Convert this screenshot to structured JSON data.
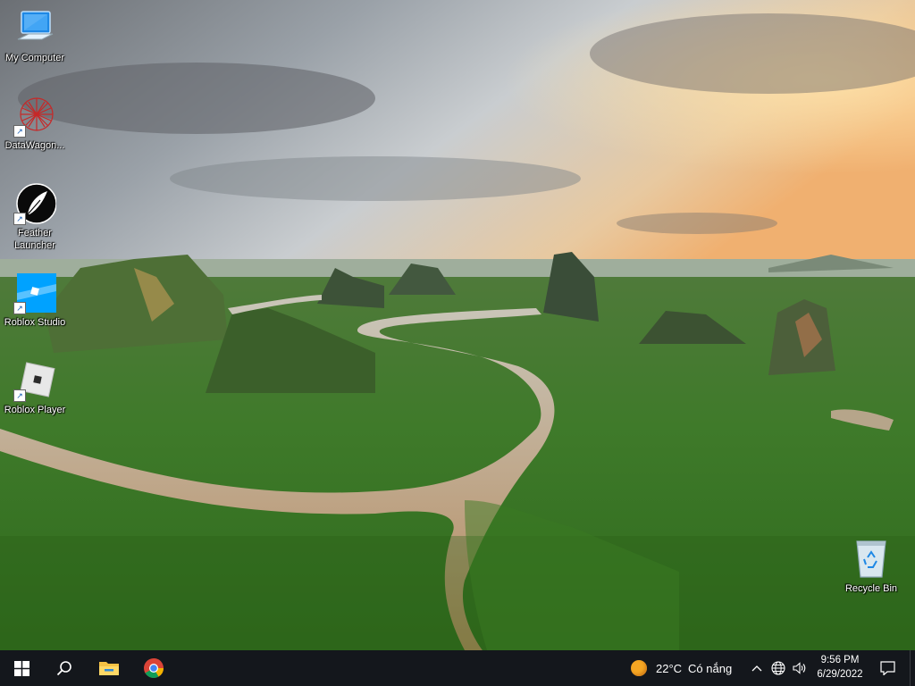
{
  "desktop": {
    "icons": [
      {
        "label": "My Computer",
        "icon": "computer-icon"
      },
      {
        "label": "DataWagon...",
        "icon": "datawagon-icon"
      },
      {
        "label": "Feather Launcher",
        "icon": "feather-launcher-icon"
      },
      {
        "label": "Roblox Studio",
        "icon": "roblox-studio-icon"
      },
      {
        "label": "Roblox Player",
        "icon": "roblox-player-icon"
      },
      {
        "label": "Recycle Bin",
        "icon": "recycle-bin-icon"
      }
    ]
  },
  "taskbar": {
    "start_icon": "windows-start-icon",
    "search_icon": "search-icon",
    "pinned": [
      {
        "icon": "file-explorer-icon"
      },
      {
        "icon": "chrome-icon"
      }
    ],
    "weather": {
      "temperature": "22°C",
      "condition": "Có nắng",
      "icon": "sun-icon"
    },
    "tray_icons": [
      "chevron-up-icon",
      "network-globe-icon",
      "speaker-icon"
    ],
    "time": "9:56 PM",
    "date": "6/29/2022",
    "notification_icon": "notification-icon"
  },
  "colors": {
    "taskbar_bg": "#14171c",
    "sun": "#f5a623"
  }
}
